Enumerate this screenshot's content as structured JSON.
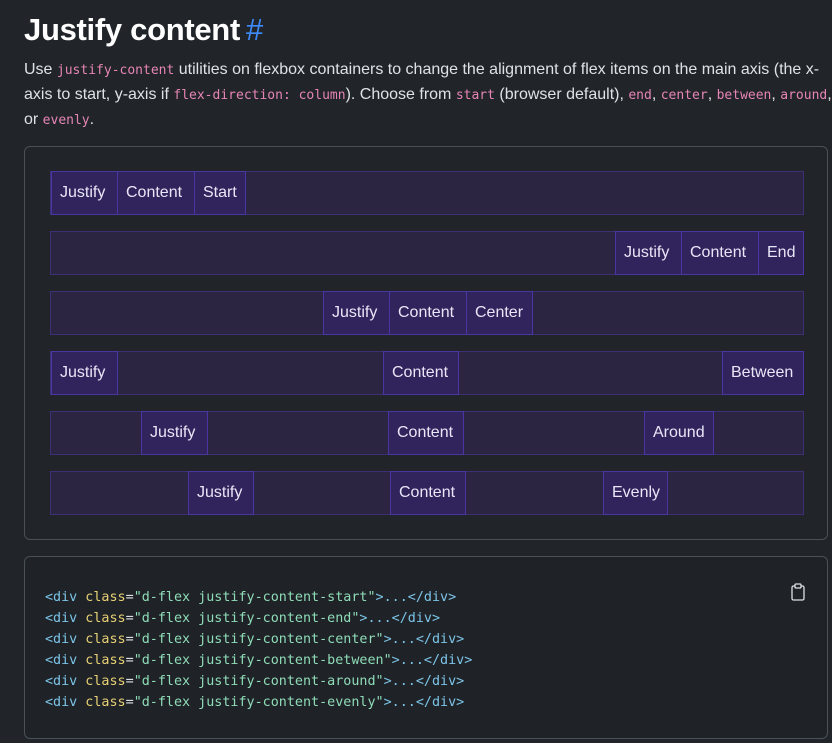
{
  "heading": {
    "title": "Justify content",
    "anchor": "#"
  },
  "lead": {
    "t1": "Use ",
    "c1": "justify-content",
    "t2": " utilities on flexbox containers to change the alignment of flex items on the main axis (the x-axis to start, y-axis if ",
    "c2": "flex-direction: column",
    "t3": "). Choose from ",
    "c3": "start",
    "t4": " (browser default), ",
    "c4": "end",
    "t5": ", ",
    "c5": "center",
    "t6": ", ",
    "c6": "between",
    "t7": ", ",
    "c7": "around",
    "t8": ", or ",
    "c8": "evenly",
    "t9": "."
  },
  "rows": [
    {
      "name": "start",
      "items": [
        "Justify",
        "Content",
        "Start"
      ]
    },
    {
      "name": "end",
      "items": [
        "Justify",
        "Content",
        "End"
      ]
    },
    {
      "name": "center",
      "items": [
        "Justify",
        "Content",
        "Center"
      ]
    },
    {
      "name": "between",
      "items": [
        "Justify",
        "Content",
        "Between"
      ]
    },
    {
      "name": "around",
      "items": [
        "Justify",
        "Content",
        "Around"
      ]
    },
    {
      "name": "evenly",
      "items": [
        "Justify",
        "Content",
        "Evenly"
      ]
    }
  ],
  "code": {
    "lines": [
      {
        "tag_open": "<div",
        "attr": " class",
        "eq": "=",
        "value": "\"d-flex justify-content-start\"",
        "rest": ">...",
        "tag_close": "</div>"
      },
      {
        "tag_open": "<div",
        "attr": " class",
        "eq": "=",
        "value": "\"d-flex justify-content-end\"",
        "rest": ">...",
        "tag_close": "</div>"
      },
      {
        "tag_open": "<div",
        "attr": " class",
        "eq": "=",
        "value": "\"d-flex justify-content-center\"",
        "rest": ">...",
        "tag_close": "</div>"
      },
      {
        "tag_open": "<div",
        "attr": " class",
        "eq": "=",
        "value": "\"d-flex justify-content-between\"",
        "rest": ">...",
        "tag_close": "</div>"
      },
      {
        "tag_open": "<div",
        "attr": " class",
        "eq": "=",
        "value": "\"d-flex justify-content-around\"",
        "rest": ">...",
        "tag_close": "</div>"
      },
      {
        "tag_open": "<div",
        "attr": " class",
        "eq": "=",
        "value": "\"d-flex justify-content-evenly\"",
        "rest": ">...",
        "tag_close": "</div>"
      }
    ],
    "copy_icon": "clipboard-icon"
  }
}
